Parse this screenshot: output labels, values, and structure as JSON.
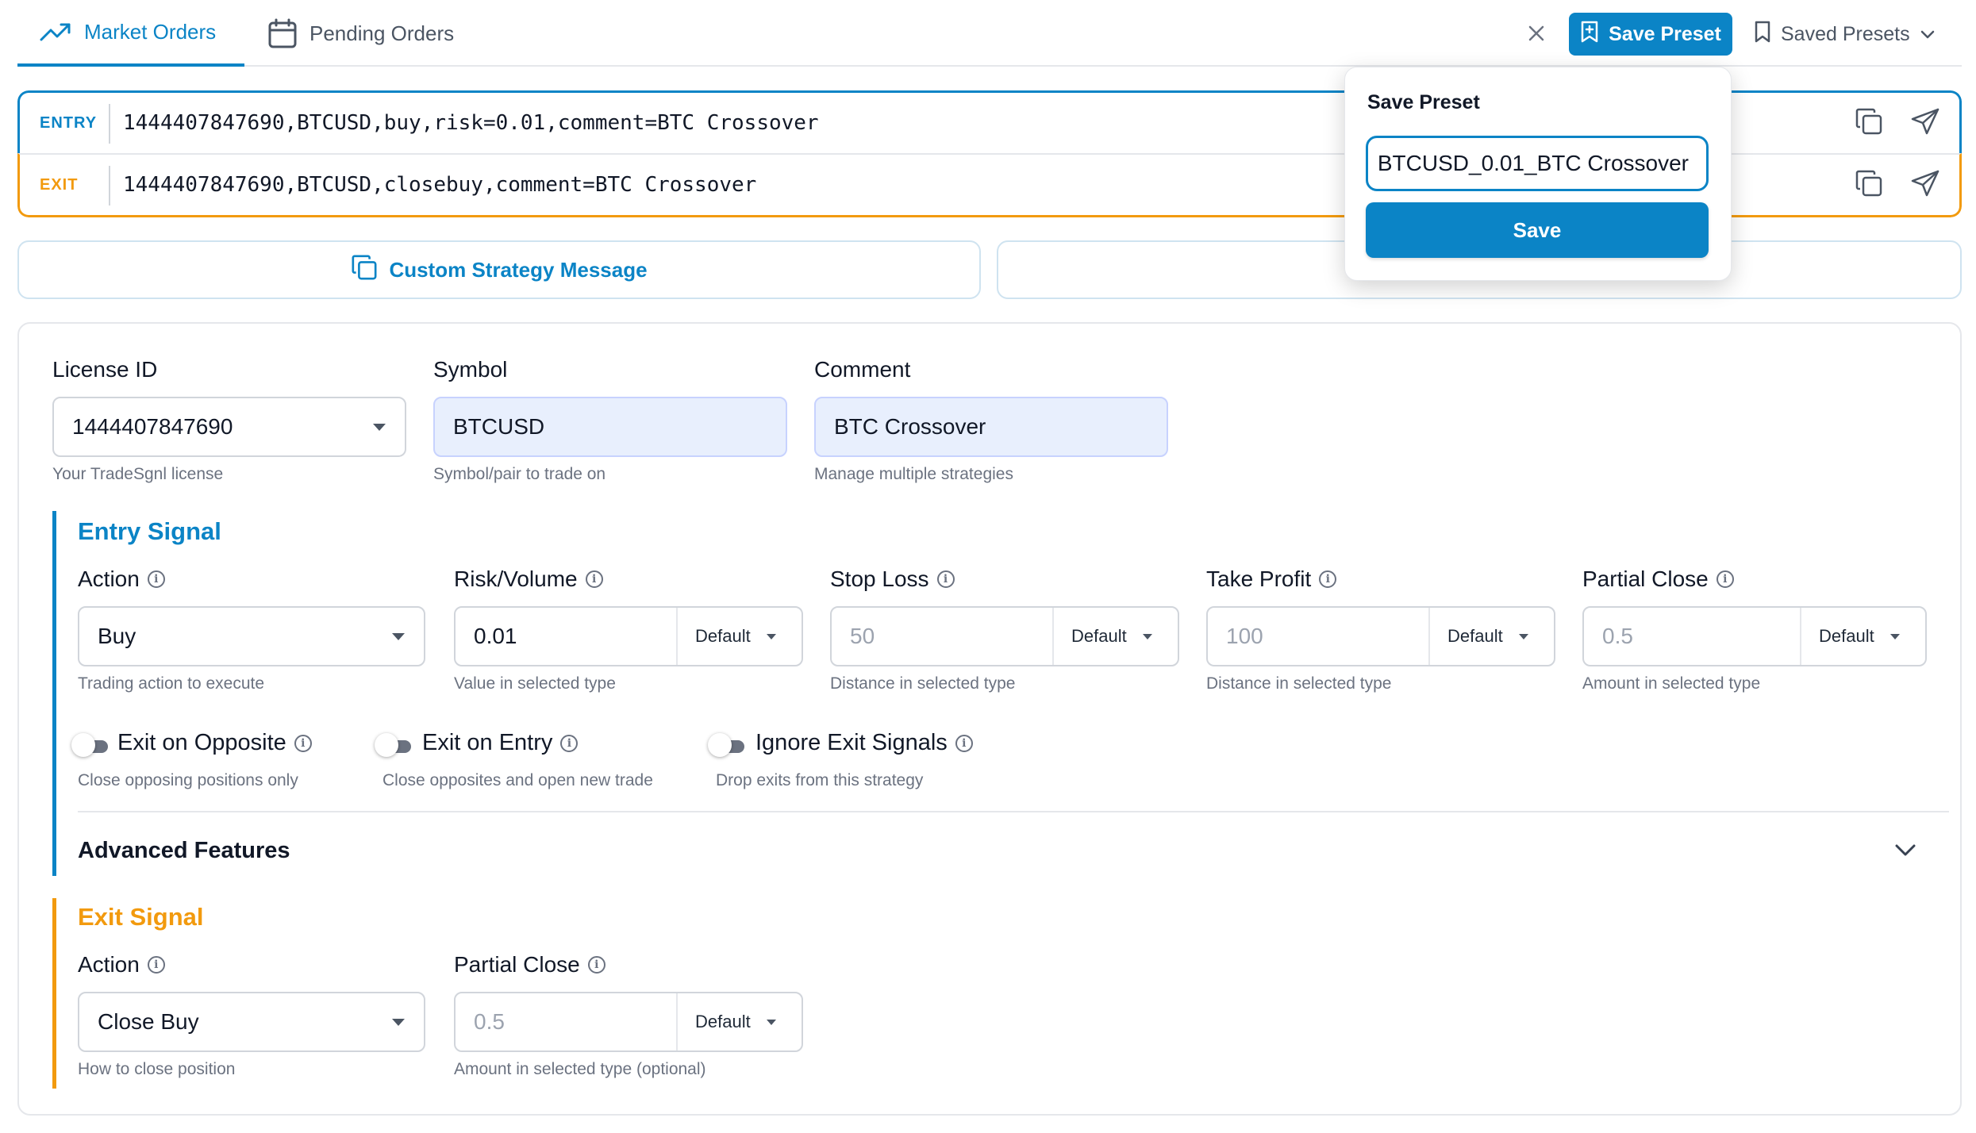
{
  "tabs": {
    "market_orders": "Market Orders",
    "pending_orders": "Pending Orders"
  },
  "header": {
    "save_preset": "Save Preset",
    "saved_presets": "Saved Presets"
  },
  "messages": {
    "entry_tag": "ENTRY",
    "entry_text": "1444407847690,BTCUSD,buy,risk=0.01,comment=BTC Crossover",
    "exit_tag": "EXIT",
    "exit_text": "1444407847690,BTCUSD,closebuy,comment=BTC Crossover"
  },
  "strategy": {
    "custom_message_label": "Custom Strategy Message"
  },
  "general": {
    "license_label": "License ID",
    "license_value": "1444407847690",
    "license_help": "Your TradeSgnl license",
    "symbol_label": "Symbol",
    "symbol_value": "BTCUSD",
    "symbol_help": "Symbol/pair to trade on",
    "comment_label": "Comment",
    "comment_value": "BTC Crossover",
    "comment_help": "Manage multiple strategies"
  },
  "entry_signal": {
    "title": "Entry Signal",
    "action_label": "Action",
    "action_value": "Buy",
    "action_help": "Trading action to execute",
    "risk_label": "Risk/Volume",
    "risk_value": "0.01",
    "risk_unit": "Default",
    "risk_help": "Value in selected type",
    "sl_label": "Stop Loss",
    "sl_placeholder": "50",
    "sl_unit": "Default",
    "sl_help": "Distance in selected type",
    "tp_label": "Take Profit",
    "tp_placeholder": "100",
    "tp_unit": "Default",
    "tp_help": "Distance in selected type",
    "pc_label": "Partial Close",
    "pc_placeholder": "0.5",
    "pc_unit": "Default",
    "pc_help": "Amount in selected type",
    "toggles": [
      {
        "label": "Exit on Opposite",
        "help": "Close opposing positions only"
      },
      {
        "label": "Exit on Entry",
        "help": "Close opposites and open new trade"
      },
      {
        "label": "Ignore Exit Signals",
        "help": "Drop exits from this strategy"
      }
    ],
    "advanced_label": "Advanced Features"
  },
  "exit_signal": {
    "title": "Exit Signal",
    "action_label": "Action",
    "action_value": "Close Buy",
    "action_help": "How to close position",
    "pc_label": "Partial Close",
    "pc_placeholder": "0.5",
    "pc_unit": "Default",
    "pc_help": "Amount in selected type (optional)"
  },
  "popover": {
    "title": "Save Preset",
    "input_value": "BTCUSD_0.01_BTC Crossover",
    "save_label": "Save"
  },
  "colors": {
    "accent": "#0b84c6",
    "exit": "#f29a0e"
  }
}
